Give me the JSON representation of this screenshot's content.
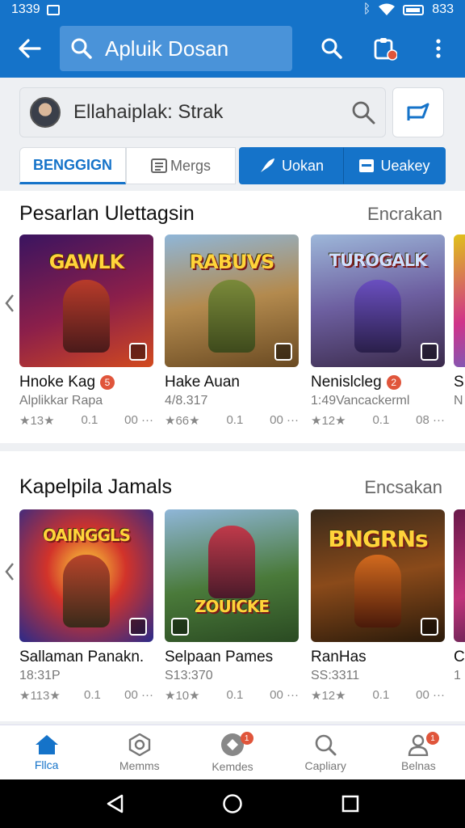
{
  "status": {
    "time": "1339",
    "battery": "833"
  },
  "appbar": {
    "search_text": "Apluik Dosan"
  },
  "subsearch": {
    "text": "Ellahaiplak: Strak"
  },
  "tabs": [
    {
      "label": "BENGGIGN"
    },
    {
      "label": "Mergs"
    },
    {
      "label": "Uokan"
    },
    {
      "label": "Ueakey"
    }
  ],
  "sections": [
    {
      "title": "Pesarlan Ulettagsin",
      "more": "Encrakan",
      "cards": [
        {
          "art": "GAWLK",
          "name": "Hnoke Kag",
          "badge": "5",
          "sub": "Alplikkar Rapa",
          "rating": "★13★",
          "size": "0.1",
          "extra": "00 ···"
        },
        {
          "art": "RABUVS",
          "name": "Hake Auan",
          "badge": "",
          "sub": "4/8.317",
          "rating": "★66★",
          "size": "0.1",
          "extra": "00 ···"
        },
        {
          "art": "TUROGALK",
          "name": "Nenislcleg",
          "badge": "2",
          "sub": "1:49Vancackerml",
          "rating": "★12★",
          "size": "0.1",
          "extra": "08 ···"
        },
        {
          "art": "",
          "name": "S",
          "badge": "",
          "sub": "N",
          "rating": "",
          "size": "",
          "extra": ""
        }
      ]
    },
    {
      "title": "Kapelpila Jamals",
      "more": "Encsakan",
      "cards": [
        {
          "art": "OAINGGLS",
          "name": "Sallaman Panakn.",
          "badge": "",
          "sub": "18:31P",
          "rating": "★113★",
          "size": "0.1",
          "extra": "00 ···"
        },
        {
          "art": "ZOUICKE",
          "name": "Selpaan Pames",
          "badge": "",
          "sub": "S13:370",
          "rating": "★10★",
          "size": "0.1",
          "extra": "00 ···"
        },
        {
          "art": "BNGRNs",
          "name": "RanHas",
          "badge": "",
          "sub": "SS:3311",
          "rating": "★12★",
          "size": "0.1",
          "extra": "00 ···"
        },
        {
          "art": "",
          "name": "C",
          "badge": "",
          "sub": "1",
          "rating": "",
          "size": "",
          "extra": ""
        }
      ]
    }
  ],
  "bottomnav": [
    {
      "label": "Fllca",
      "icon": "home-icon"
    },
    {
      "label": "Memms",
      "icon": "badge-icon"
    },
    {
      "label": "Kemdes",
      "icon": "puzzle-icon",
      "badge": "1"
    },
    {
      "label": "Capliary",
      "icon": "search-icon"
    },
    {
      "label": "Belnas",
      "icon": "profile-icon",
      "badge": "1"
    }
  ],
  "colors": {
    "accent": "#1573c9",
    "badge": "#e0553b"
  }
}
